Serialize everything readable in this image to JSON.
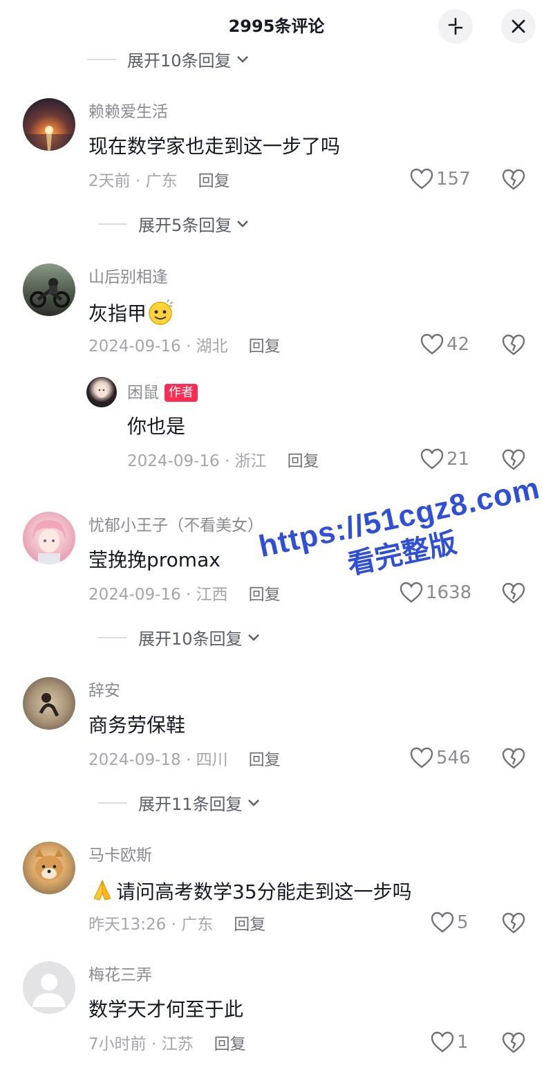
{
  "header": {
    "title": "2995条评论"
  },
  "expand_labels": {
    "top": "展开10条回复",
    "c1": "展开5条回复",
    "c4": "展开10条回复",
    "c5": "展开11条回复"
  },
  "comments": [
    {
      "name": "赖赖爱生活",
      "text": "现在数学家也走到这一步了吗",
      "time": "2天前 · 广东",
      "reply": "回复",
      "likes": "157"
    },
    {
      "name": "山后别相逢",
      "text": "灰指甲",
      "time": "2024-09-16 · 湖北",
      "reply": "回复",
      "likes": "42"
    },
    {
      "name": "困鼠",
      "badge": "作者",
      "text": "你也是",
      "time": "2024-09-16 · 浙江",
      "reply": "回复",
      "likes": "21"
    },
    {
      "name": "忧郁小王子（不看美女）",
      "text": "莹挽挽promax",
      "time": "2024-09-16 · 江西",
      "reply": "回复",
      "likes": "1638"
    },
    {
      "name": "辞安",
      "text": "商务劳保鞋",
      "time": "2024-09-18 · 四川",
      "reply": "回复",
      "likes": "546"
    },
    {
      "name": "马卡欧斯",
      "text": "请问高考数学35分能走到这一步吗",
      "time": "昨天13:26 · 广东",
      "reply": "回复",
      "likes": "5"
    },
    {
      "name": "梅花三弄",
      "text": "数学天才何至于此",
      "time": "7小时前 · 江苏",
      "reply": "回复",
      "likes": "1"
    }
  ],
  "watermark": {
    "line1": "https://51cgz8.com",
    "line2": "看完整版"
  },
  "colors": {
    "text": "#161823",
    "meta": "#a5a6ab",
    "badge": "#fe2c55",
    "watermark": "#2f4fd8"
  }
}
